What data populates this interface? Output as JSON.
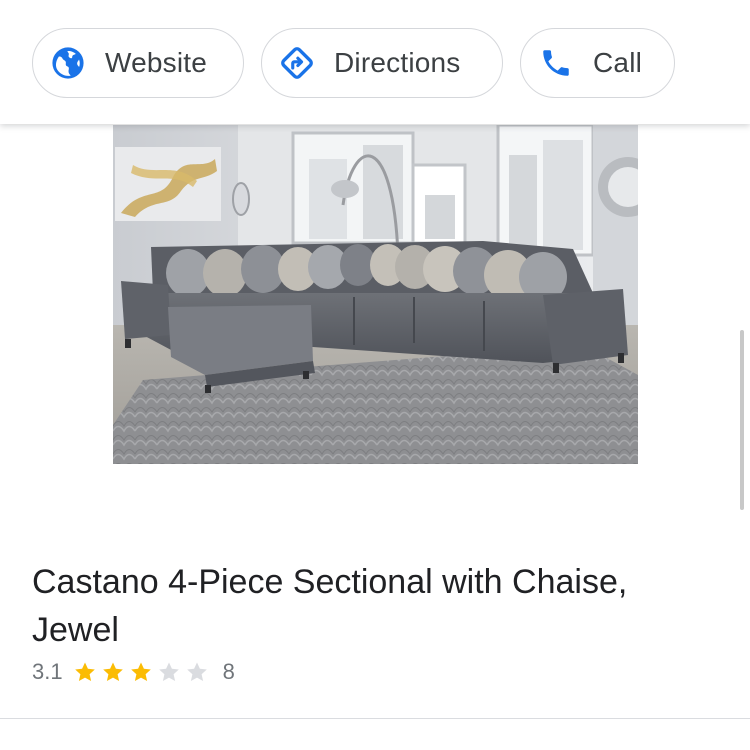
{
  "actions": {
    "website": {
      "label": "Website",
      "icon": "globe-icon"
    },
    "directions": {
      "label": "Directions",
      "icon": "directions-icon"
    },
    "call": {
      "label": "Call",
      "icon": "phone-icon"
    }
  },
  "product": {
    "title": "Castano 4-Piece Sectional with Chaise, Jewel",
    "rating": "3.1",
    "stars_filled": 3,
    "stars_total": 5,
    "review_count": "8"
  },
  "colors": {
    "accent_blue": "#1a73e8",
    "star_gold": "#fbbc04",
    "star_empty": "#dadce0",
    "chip_border": "#d5d7db",
    "text_secondary": "#70757a"
  }
}
